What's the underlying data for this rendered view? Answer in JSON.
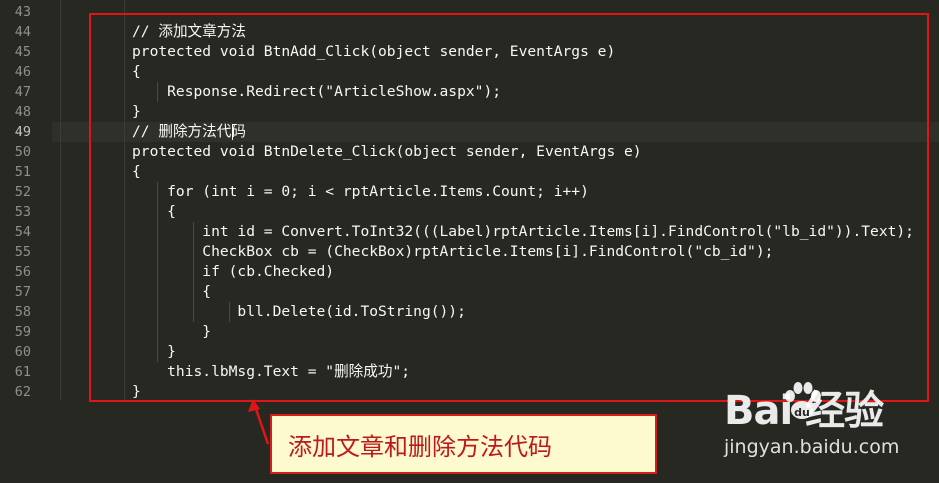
{
  "editor": {
    "line_numbers": [
      "43",
      "44",
      "45",
      "46",
      "47",
      "48",
      "49",
      "50",
      "51",
      "52",
      "53",
      "54",
      "55",
      "56",
      "57",
      "58",
      "59",
      "60",
      "61",
      "62"
    ],
    "active_line": "49",
    "code_lines": [
      "",
      "// 添加文章方法",
      "protected void BtnAdd_Click(object sender, EventArgs e)",
      "{",
      "    Response.Redirect(\"ArticleShow.aspx\");",
      "}",
      "// 删除方法代码",
      "protected void BtnDelete_Click(object sender, EventArgs e)",
      "{",
      "    for (int i = 0; i < rptArticle.Items.Count; i++)",
      "    {",
      "        int id = Convert.ToInt32(((Label)rptArticle.Items[i].FindControl(\"lb_id\")).Text);",
      "        CheckBox cb = (CheckBox)rptArticle.Items[i].FindControl(\"cb_id\");",
      "        if (cb.Checked)",
      "        {",
      "            bll.Delete(id.ToString());",
      "        }",
      "    }",
      "    this.lbMsg.Text = \"删除成功\";",
      "}"
    ]
  },
  "annotation": {
    "callout_text": "添加文章和删除方法代码",
    "box_color": "#e01616"
  },
  "watermark": {
    "brand": "Bai  经验",
    "url": "jingyan.baidu.com"
  }
}
